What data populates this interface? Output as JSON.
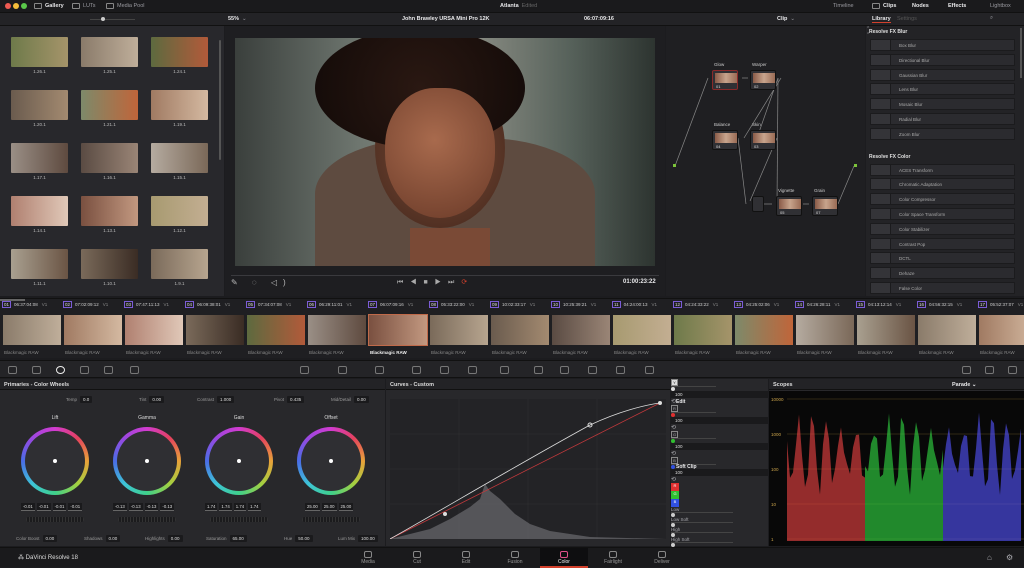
{
  "titlebar": {
    "tabs": [
      "Gallery",
      "LUTs",
      "Media Pool"
    ],
    "project": "Atlanta",
    "status": "Edited",
    "right_tabs": [
      "Timeline",
      "Clips",
      "Nodes",
      "Effects",
      "Lightbox"
    ]
  },
  "viewer_bar": {
    "zoom": "55%",
    "clip_name": "John Brawley URSA Mini Pro 12K",
    "timecode": "06:07:09:16",
    "node_mode": "Clip"
  },
  "library": {
    "tabs": [
      "Library",
      "Settings"
    ],
    "sections": [
      {
        "title": "Resolve FX Blur",
        "items": [
          "Box Blur",
          "Directional Blur",
          "Gaussian Blur",
          "Lens Blur",
          "Mosaic Blur",
          "Radial Blur",
          "Zoom Blur"
        ]
      },
      {
        "title": "Resolve FX Color",
        "items": [
          "ACES Transform",
          "Chromatic Adaptation",
          "Color Compressor",
          "Color Space Transform",
          "Color Stabilizer",
          "Contrast Pop",
          "DCTL",
          "Dehaze",
          "False Color"
        ]
      }
    ]
  },
  "gallery": {
    "stills": [
      "1.26.1",
      "1.25.1",
      "1.24.1",
      "1.20.1",
      "1.21.1",
      "1.19.1",
      "1.17.1",
      "1.16.1",
      "1.15.1",
      "1.14.1",
      "1.13.1",
      "1.12.1",
      "1.11.1",
      "1.10.1",
      "1.9.1"
    ]
  },
  "transport": {
    "timecode": "01:00:23:22"
  },
  "nodes": [
    {
      "label": "Glow",
      "num": "01"
    },
    {
      "label": "Warper",
      "num": "02"
    },
    {
      "label": "Balance",
      "num": "04"
    },
    {
      "label": "Skin",
      "num": "03"
    },
    {
      "label": "Vignette",
      "num": "05"
    },
    {
      "label": "Grain",
      "num": "07"
    }
  ],
  "clips": {
    "track": "V1",
    "codec": "Blackmagic RAW",
    "selected": "07",
    "items": [
      [
        "01",
        "06:37:04:08"
      ],
      [
        "02",
        "07:02:09:12"
      ],
      [
        "03",
        "07:47:11:13"
      ],
      [
        "04",
        "06:09:38:01"
      ],
      [
        "05",
        "07:34:07:08"
      ],
      [
        "06",
        "06:29:11:01"
      ],
      [
        "07",
        "06:07:09:16"
      ],
      [
        "08",
        "05:33:22:00"
      ],
      [
        "09",
        "10:02:33:17"
      ],
      [
        "10",
        "10:25:39:21"
      ],
      [
        "11",
        "04:24:00:13"
      ],
      [
        "12",
        "04:24:33:22"
      ],
      [
        "13",
        "04:25:02:06"
      ],
      [
        "14",
        "04:26:28:11"
      ],
      [
        "15",
        "04:13:12:14"
      ],
      [
        "16",
        "04:56:32:15"
      ],
      [
        "17",
        "05:52:37:07"
      ]
    ]
  },
  "primaries": {
    "title": "Primaries - Color Wheels",
    "temp": {
      "label": "Temp",
      "value": "0.0"
    },
    "tint": {
      "label": "Tint",
      "value": "0.00"
    },
    "contrast": {
      "label": "Contrast",
      "value": "1.000"
    },
    "pivot": {
      "label": "Pivot",
      "value": "0.435"
    },
    "mid_detail": {
      "label": "Mid/Detail",
      "value": "0.00"
    },
    "wheels": [
      {
        "name": "Lift",
        "values": [
          "-0.01",
          "-0.01",
          "-0.01",
          "-0.01"
        ]
      },
      {
        "name": "Gamma",
        "values": [
          "-0.13",
          "-0.13",
          "-0.13",
          "-0.13"
        ]
      },
      {
        "name": "Gain",
        "values": [
          "1.74",
          "1.74",
          "1.74",
          "1.74"
        ]
      },
      {
        "name": "Offset",
        "values": [
          "25.00",
          "25.00",
          "25.00"
        ]
      }
    ],
    "bottom": [
      {
        "label": "Color Boost",
        "value": "0.00"
      },
      {
        "label": "Shadows",
        "value": "0.00"
      },
      {
        "label": "Highlights",
        "value": "0.00"
      },
      {
        "label": "Saturation",
        "value": "65.00"
      },
      {
        "label": "Hue",
        "value": "50.00"
      },
      {
        "label": "Lum Mix",
        "value": "100.00"
      }
    ]
  },
  "curves": {
    "title": "Curves - Custom"
  },
  "edit": {
    "title": "Edit",
    "channels": [
      "Y",
      "R",
      "G",
      "B"
    ],
    "values": [
      "100",
      "100",
      "100",
      "100"
    ],
    "soft_clip": "Soft Clip",
    "soft_clip_channels": [
      "R",
      "G",
      "B"
    ],
    "sliders": [
      "Low",
      "Low Soft",
      "High",
      "High Soft"
    ]
  },
  "scopes": {
    "title": "Scopes",
    "mode": "Parade",
    "scale": [
      "10000",
      "1000",
      "100",
      "10",
      "1"
    ]
  },
  "app": {
    "name": "DaVinci Resolve 18"
  },
  "pages": {
    "items": [
      "Media",
      "Cut",
      "Edit",
      "Fusion",
      "Color",
      "Fairlight",
      "Deliver"
    ],
    "active": "Color"
  },
  "colors": {
    "accent": "#d2402c",
    "selection": "#c06a4a"
  }
}
